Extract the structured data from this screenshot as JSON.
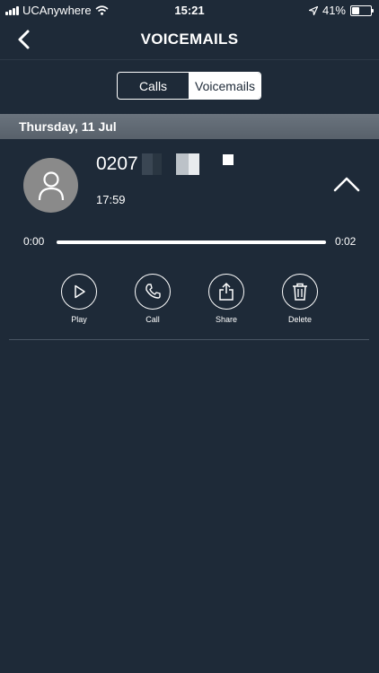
{
  "status_bar": {
    "carrier": "UCAnywhere",
    "time": "15:21",
    "battery": "41%",
    "battery_level": 0.41
  },
  "nav": {
    "title": "VOICEMAILS",
    "back_icon": "chevron-left-icon"
  },
  "tabs": [
    {
      "label": "Calls",
      "active": false
    },
    {
      "label": "Voicemails",
      "active": true
    }
  ],
  "section": {
    "date": "Thursday, 11 Jul"
  },
  "voicemail": {
    "number": "0207",
    "time": "17:59",
    "avatar_icon": "user-icon",
    "expand_icon": "chevron-up-icon"
  },
  "player": {
    "start": "0:00",
    "end": "0:02",
    "progress": 1.0
  },
  "actions": [
    {
      "label": "Play",
      "icon": "play-icon"
    },
    {
      "label": "Call",
      "icon": "phone-icon"
    },
    {
      "label": "Share",
      "icon": "share-icon"
    },
    {
      "label": "Delete",
      "icon": "trash-icon"
    }
  ],
  "colors": {
    "background": "#1e2a38",
    "header_band": "#5f6872",
    "foreground": "#ffffff"
  }
}
